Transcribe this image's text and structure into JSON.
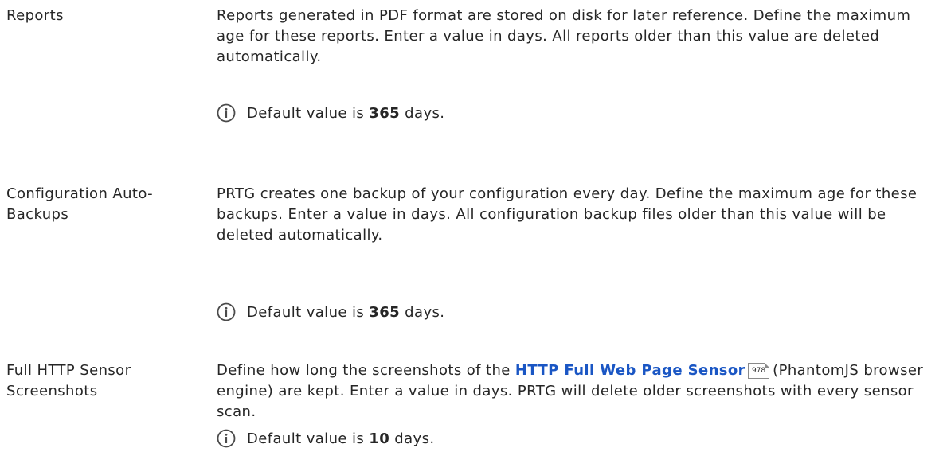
{
  "settings": [
    {
      "label": "Reports",
      "description": "Reports generated in PDF format are stored on disk for later reference. Define the maximum age for these reports. Enter a value in days. All reports older than this value are deleted automatically.",
      "note": {
        "prefix": "Default value is ",
        "value": "365",
        "suffix": " days."
      }
    },
    {
      "label": "Configuration Auto-Backups",
      "description": "PRTG creates one backup of your configuration every day. Define the maximum age for these backups. Enter a value in days. All configuration backup files older than this value will be deleted automatically.",
      "note": {
        "prefix": "Default value is ",
        "value": "365",
        "suffix": " days."
      }
    },
    {
      "label": "Full HTTP Sensor Screenshots",
      "description_pre": "Define how long the screenshots of the ",
      "link_text": "HTTP Full Web Page Sensor",
      "page_ref": "978",
      "description_post": "(PhantomJS browser engine) are kept. Enter a value in days. PRTG will delete older screenshots with every sensor scan.",
      "note": {
        "prefix": "Default value is ",
        "value": "10",
        "suffix": " days."
      }
    }
  ],
  "icons": {
    "note_icon": "info-icon",
    "accent": "#1a56c4"
  }
}
